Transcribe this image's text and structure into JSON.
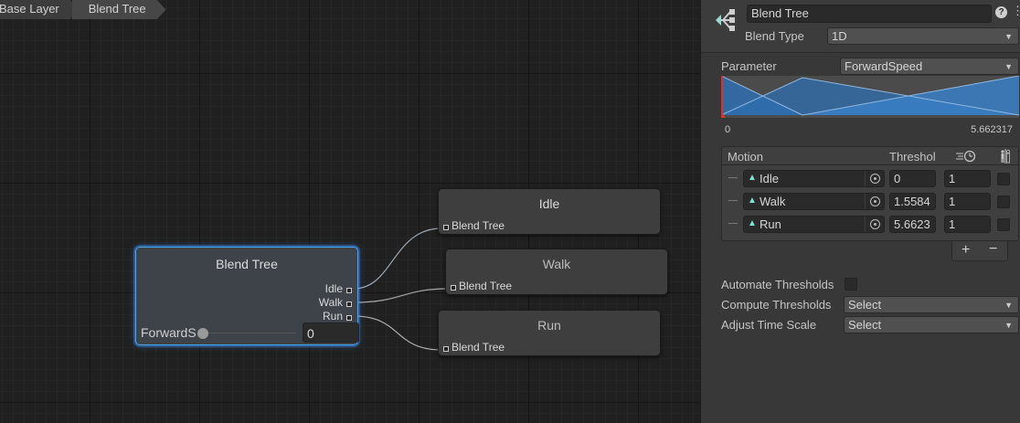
{
  "breadcrumb": [
    "Base Layer",
    "Blend Tree"
  ],
  "graph": {
    "blend_tree_node": {
      "title": "Blend Tree",
      "outputs": [
        "Idle",
        "Walk",
        "Run"
      ],
      "parameter_name": "ForwardSpeed",
      "parameter_value": "0"
    },
    "children": [
      {
        "title": "Idle",
        "input_label": "Blend Tree"
      },
      {
        "title": "Walk",
        "input_label": "Blend Tree"
      },
      {
        "title": "Run",
        "input_label": "Blend Tree"
      }
    ]
  },
  "inspector": {
    "name": "Blend Tree",
    "blend_type_label": "Blend Type",
    "blend_type": "1D",
    "parameter_label": "Parameter",
    "parameter": "ForwardSpeed",
    "range_min": "0",
    "range_max": "5.662317",
    "table": {
      "col_motion": "Motion",
      "col_threshold": "Threshold",
      "rows": [
        {
          "motion": "Idle",
          "threshold": "0",
          "speed": "1"
        },
        {
          "motion": "Walk",
          "threshold": "1.5584",
          "speed": "1"
        },
        {
          "motion": "Run",
          "threshold": "5.6623",
          "speed": "1"
        }
      ]
    },
    "add_label": "+",
    "remove_label": "−",
    "automate_label": "Automate Thresholds",
    "compute_label": "Compute Thresholds",
    "compute_value": "Select",
    "adjust_label": "Adjust Time Scale",
    "adjust_value": "Select"
  },
  "colors": {
    "selection": "#4aa7ff",
    "clip_icon": "#7de3d4",
    "curve_fill": "#2f6db0"
  },
  "icons": [
    "blend-tree-icon",
    "help-icon",
    "kebab-menu-icon",
    "clock-speed-icon",
    "mirror-icon",
    "object-picker-icon",
    "animation-clip-icon"
  ]
}
